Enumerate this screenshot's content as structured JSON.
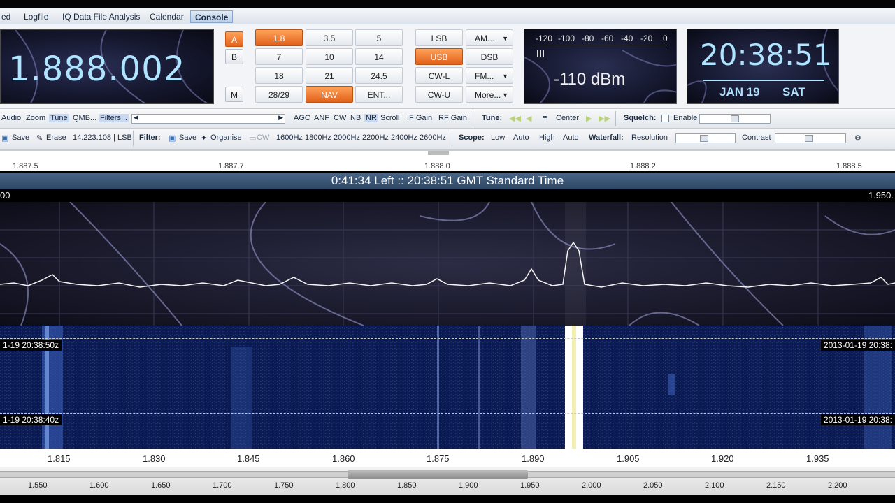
{
  "tabs": [
    "ed",
    "Logfile",
    "IQ Data File Analysis",
    "Calendar",
    "Console"
  ],
  "active_tab": "Console",
  "frequency": "1.888.002",
  "vfo_buttons": [
    "A",
    "B",
    "M"
  ],
  "band_buttons": [
    "1.8",
    "3.5",
    "5",
    "7",
    "10",
    "14",
    "18",
    "21",
    "24.5",
    "28/29",
    "NAV",
    "ENT..."
  ],
  "mode_buttons": [
    "LSB",
    "AM...",
    "USB",
    "DSB",
    "CW-L",
    "FM...",
    "CW-U",
    "More..."
  ],
  "smeter": {
    "scale": [
      "-120",
      "-100",
      "-80",
      "-60",
      "-40",
      "-20",
      "0"
    ],
    "reading": "-110 dBm"
  },
  "clock": {
    "time": "20:38:51",
    "date": "JAN 19",
    "day": "SAT"
  },
  "ribbon1": {
    "audio": "Audio",
    "zoom": "Zoom",
    "tune": "Tune",
    "qmb": "QMB...",
    "filters": "Filters...",
    "agc": "AGC",
    "anf": "ANF",
    "cw": "CW",
    "nb": "NB",
    "nr": "NR",
    "scroll": "Scroll",
    "if_gain": "IF Gain",
    "rf_gain": "RF Gain",
    "tune_label": "Tune:",
    "center": "Center",
    "squelch": "Squelch:",
    "enable": "Enable"
  },
  "ribbon2": {
    "save": "Save",
    "erase": "Erase",
    "memory": "14.223.108 | LSB",
    "filter_label": "Filter:",
    "save2": "Save",
    "organise": "Organise",
    "cw": "CW",
    "filters": [
      "1600Hz",
      "1800Hz",
      "2000Hz",
      "2200Hz",
      "2400Hz",
      "2600Hz"
    ],
    "scope": "Scope:",
    "low": "Low",
    "auto1": "Auto",
    "high": "High",
    "auto2": "Auto",
    "waterfall": "Waterfall:",
    "resolution": "Resolution",
    "contrast": "Contrast"
  },
  "ruler_labels": [
    "1.887.5",
    "1.887.7",
    "1.888.0",
    "1.888.2",
    "1.888.5"
  ],
  "info_bar": "0:41:34 Left  ::  20:38:51 GMT Standard Time",
  "spectrum_head": {
    "left": "00",
    "right": "1.950."
  },
  "waterfall_labels": {
    "t1_left": "1-19  20:38:50z",
    "t1_right": "2013-01-19  20:38:",
    "t2_left": "1-19  20:38:40z",
    "t2_right": "2013-01-19  20:38:"
  },
  "axis_main": [
    "1.815",
    "1.830",
    "1.845",
    "1.860",
    "1.875",
    "1.890",
    "1.905",
    "1.920",
    "1.935"
  ],
  "axis_overview": [
    "1.550",
    "1.600",
    "1.650",
    "1.700",
    "1.750",
    "1.800",
    "1.850",
    "1.900",
    "1.950",
    "2.000",
    "2.050",
    "2.100",
    "2.150",
    "2.200"
  ],
  "colors": {
    "accent": "#e6621c",
    "display_text": "#aee4ff",
    "info_bar": "#3a5678"
  }
}
